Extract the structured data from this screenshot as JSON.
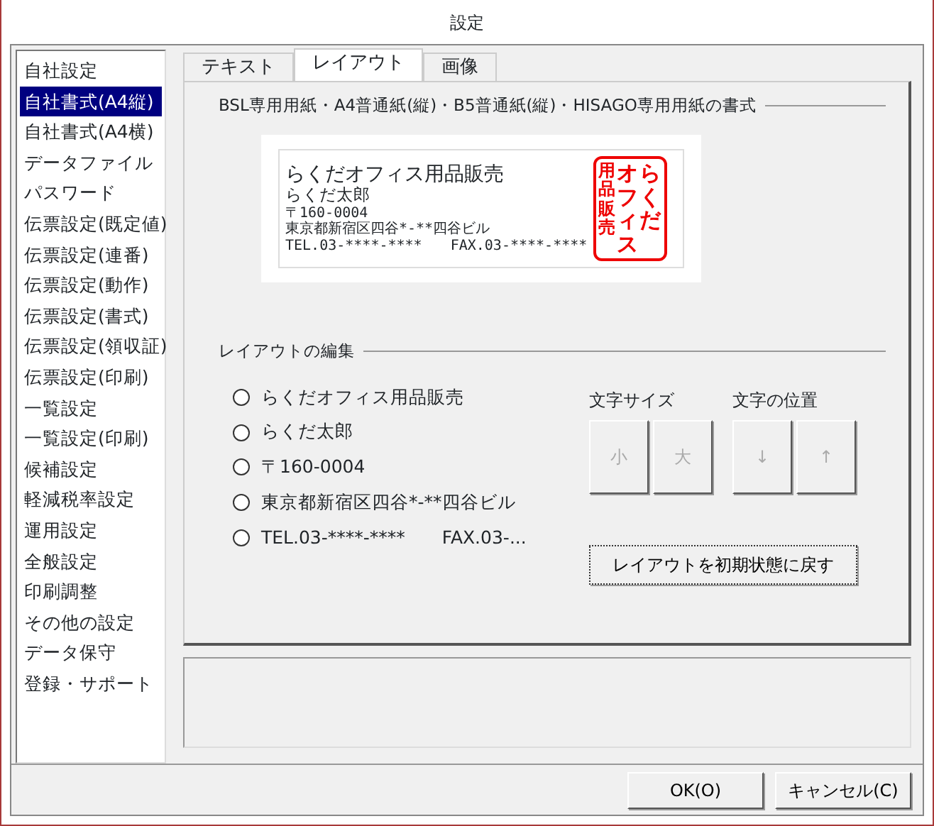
{
  "window": {
    "title": "設定"
  },
  "sidebar": {
    "items": [
      {
        "label": "自社設定",
        "selected": false
      },
      {
        "label": "自社書式(A4縦)",
        "selected": true
      },
      {
        "label": "自社書式(A4横)",
        "selected": false
      },
      {
        "label": "データファイル",
        "selected": false
      },
      {
        "label": "パスワード",
        "selected": false
      },
      {
        "label": "伝票設定(既定値)",
        "selected": false
      },
      {
        "label": "伝票設定(連番)",
        "selected": false
      },
      {
        "label": "伝票設定(動作)",
        "selected": false
      },
      {
        "label": "伝票設定(書式)",
        "selected": false
      },
      {
        "label": "伝票設定(領収証)",
        "selected": false
      },
      {
        "label": "伝票設定(印刷)",
        "selected": false
      },
      {
        "label": "一覧設定",
        "selected": false
      },
      {
        "label": "一覧設定(印刷)",
        "selected": false
      },
      {
        "label": "候補設定",
        "selected": false
      },
      {
        "label": "軽減税率設定",
        "selected": false
      },
      {
        "label": "運用設定",
        "selected": false
      },
      {
        "label": "全般設定",
        "selected": false
      },
      {
        "label": "印刷調整",
        "selected": false
      },
      {
        "label": "その他の設定",
        "selected": false
      },
      {
        "label": "データ保守",
        "selected": false
      },
      {
        "label": "登録・サポート",
        "selected": false
      }
    ]
  },
  "tabs": [
    {
      "label": "テキスト",
      "selected": false
    },
    {
      "label": "レイアウト",
      "selected": true
    },
    {
      "label": "画像",
      "selected": false
    }
  ],
  "format_group": {
    "title": "BSL専用用紙・A4普通紙(縦)・B5普通紙(縦)・HISAGO専用用紙の書式",
    "preview_lines": [
      {
        "text": "らくだオフィス用品販売",
        "kind": "large"
      },
      {
        "text": "らくだ太郎",
        "kind": "medium"
      },
      {
        "text": "〒160-0004",
        "kind": "small"
      },
      {
        "text": "東京都新宿区四谷*-**四谷ビル",
        "kind": "small"
      },
      {
        "text": "TEL.03-****-****　　FAX.03-****-****",
        "kind": "small"
      }
    ],
    "stamp_columns": [
      "用品販売",
      "オフィス",
      "らくだ"
    ]
  },
  "layout_group": {
    "title": "レイアウトの編集",
    "options": [
      {
        "label": "らくだオフィス用品販売",
        "selected": false
      },
      {
        "label": "らくだ太郎",
        "selected": false
      },
      {
        "label": "〒160-0004",
        "selected": false
      },
      {
        "label": "東京都新宿区四谷*-**四谷ビル",
        "selected": false
      },
      {
        "label": "TEL.03-****-****　　FAX.03-...",
        "selected": false
      }
    ],
    "size_label": "文字サイズ",
    "size_buttons": [
      {
        "label": "小",
        "disabled": true
      },
      {
        "label": "大",
        "disabled": true
      }
    ],
    "position_label": "文字の位置",
    "position_buttons": [
      {
        "label": "↓",
        "disabled": true
      },
      {
        "label": "↑",
        "disabled": true
      }
    ],
    "reset_button": "レイアウトを初期状態に戻す"
  },
  "buttons": [
    "OK(O)",
    "キャンセル(C)"
  ]
}
